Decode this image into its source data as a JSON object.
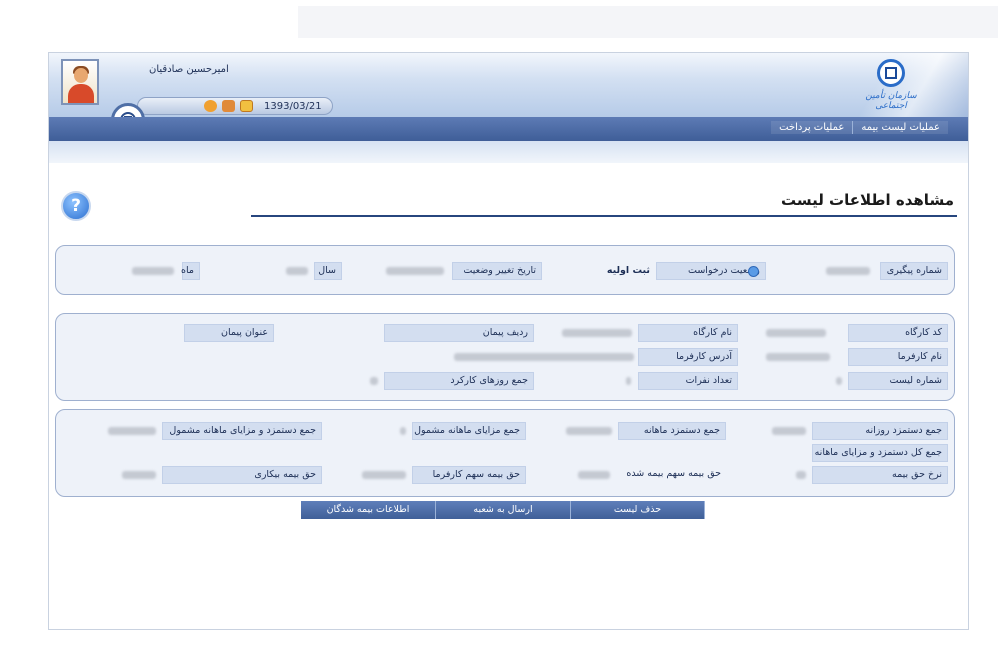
{
  "header": {
    "user_name": "امیرحسین صادقیان",
    "date": "1393/03/21",
    "logo_text": "سازمان تأمین اجتماعی",
    "icons": [
      "user-avatar-icon",
      "settings-icon",
      "home-icon",
      "mail-icon",
      "emblem-icon"
    ]
  },
  "nav": {
    "items": [
      "عملیات لیست بیمه",
      "عملیات پرداخت"
    ]
  },
  "page": {
    "title": "مشاهده اطلاعات لیست",
    "help_icon": "?"
  },
  "status_panel": {
    "tracking_label": "شماره پیگیری",
    "request_status_label": "وضعیت درخواست",
    "request_status_value": "ثبت اولیه",
    "status_change_date_label": "تاریخ تغییر وضعیت",
    "year_label": "سال",
    "month_label": "ماه"
  },
  "workshop_panel": {
    "workshop_code_label": "کد کارگاه",
    "workshop_name_label": "نام کارگاه",
    "contract_row_label": "ردیف پیمان",
    "contract_title_label": "عنوان پیمان",
    "employer_name_label": "نام کارفرما",
    "employer_address_label": "آدرس کارفرما",
    "list_number_label": "شماره لیست",
    "personnel_count_label": "تعداد نفرات",
    "work_days_total_label": "جمع روزهای کارکرد"
  },
  "wage_panel": {
    "daily_wage_total_label": "جمع دستمزد روزانه",
    "monthly_wage_total_label": "جمع دستمزد ماهانه",
    "monthly_benefits_total_label": "جمع مزایای ماهانه مشمول",
    "wage_benefits_total_label": "جمع دستمزد و مزایای ماهانه مشمول",
    "grand_total_label": "جمع کل دستمزد و مزایای ماهانه",
    "insurance_rate_label": "نرخ حق بیمه",
    "insured_share_label": "حق بیمه سهم بیمه شده",
    "employer_share_label": "حق بیمه سهم کارفرما",
    "unemployment_insurance_label": "حق بیمه بیکاری"
  },
  "buttons": {
    "delete_list": "حذف لیست",
    "send_to_branch": "ارسال به شعبه",
    "insured_info": "اطلاعات بیمه شدگان"
  }
}
